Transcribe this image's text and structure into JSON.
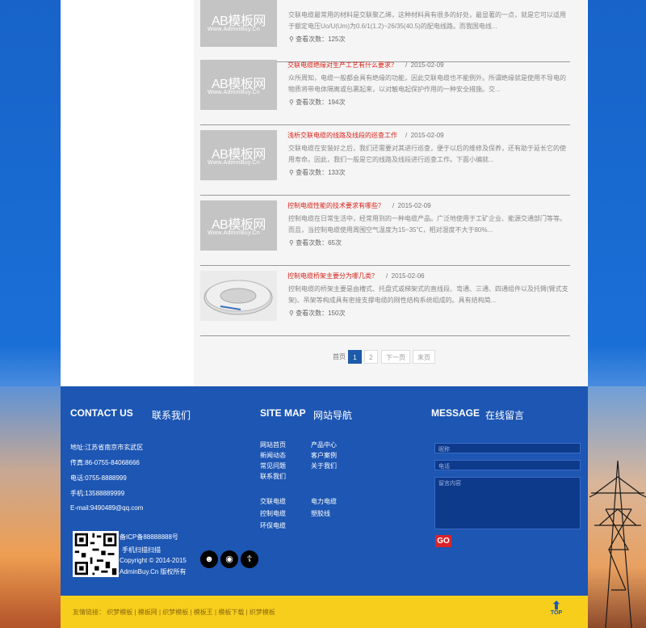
{
  "articles": [
    {
      "title": "",
      "date": "",
      "desc": "交联电缆最常用的材料是交联聚乙烯，这种材料具有很多的好处，最显著的一点，就是它可以适用于额定电压Uo/U(Um)为0.6/1(1.2)~26/35(40.5)的配电线路。而我国电线...",
      "views": "查看次数：125次",
      "thumb_logo": "AB模板网",
      "thumb_sub": "Www.AdminBuy.Cn"
    },
    {
      "title": "交联电缆绝缘对生产工艺有什么要求？",
      "date": "2015-02-09",
      "desc": "众所周知，电缆一般都会具有绝缘的功能，因此交联电缆也不能例外。所谓绝缘就是使用不导电的物质将带电体隔离或包裹起来，以对触电起保护作用的一种安全措施。交...",
      "views": "查看次数：194次",
      "thumb_logo": "AB模板网",
      "thumb_sub": "Www.AdminBuy.Cn"
    },
    {
      "title": "浅析交联电缆的线路及线段的巡查工作",
      "date": "2015-02-09",
      "desc": "交联电缆在安装好之后，我们还需要对其进行巡查，便于以后的维修及保养，还有助于延长它的使用寿命。因此，我们一般是它的线路及线段进行巡查工作。下面小编就...",
      "views": "查看次数：133次",
      "thumb_logo": "AB模板网",
      "thumb_sub": "Www.AdminBuy.Cn"
    },
    {
      "title": "控制电缆性能的技术要求有哪些？",
      "date": "2015-02-09",
      "desc": "控制电缆在日常生活中，经常用到的一种电缆产品。广泛地使用于工矿企业、能源交通部门等等。而且，当控制电缆使用周围空气温度为15~35℃，相对湿度不大于80%...",
      "views": "查看次数：65次",
      "thumb_logo": "AB模板网",
      "thumb_sub": "Www.AdminBuy.Cn"
    },
    {
      "title": "控制电缆桥架主要分为哪几类？",
      "date": "2015-02-06",
      "desc": "控制电缆的桥架主要是由槽式、托盘式或梯架式的直线段、弯通、三通、四通组件以及托臂(臂式支架)、吊架等构成具有密接支撑电缆的刚性结构系统组成的。具有结构简...",
      "views": "查看次数：150次",
      "thumb_logo": "",
      "thumb_sub": ""
    }
  ],
  "pager": {
    "first": "首页",
    "page1": "1",
    "page2": "2",
    "next": "下一页",
    "last": "末页"
  },
  "footer": {
    "contact_en": "CONTACT US",
    "contact_cn": "联系我们",
    "sitemap_en": "SITE MAP",
    "sitemap_cn": "网站导航",
    "message_en": "MESSAGE",
    "message_cn": "在线留言",
    "address": "地址:江苏省南京市玄武区",
    "fax": "传真:86-0755-84068666",
    "phone": "电话:0755-8888999",
    "mobile": "手机:13588889999",
    "email": "E-mail:9490489@qq.com",
    "icp": "备ICP备88888888号",
    "qr_hint": "手机扫描扫描",
    "copyright": "Copyright © 2014-2015",
    "rights": "AdminBuy.Cn 版权所有",
    "nav_col1": [
      "网站首页",
      "新闻动态",
      "常见问题",
      "联系我们"
    ],
    "nav_col2": [
      "产品中心",
      "客户案例",
      "关于我们"
    ],
    "prod_col1": [
      "交联电缆",
      "控制电缆",
      "环保电缆"
    ],
    "prod_col2": [
      "电力电缆",
      "塑胶线"
    ],
    "ph_name": "昵称",
    "ph_phone": "电话",
    "ph_content": "留言内容",
    "go": "GO"
  },
  "friend_links": "友情链接：  织梦模板  |  模板网  |  织梦模板  |  模板王  |  模板下载  |  织梦模板",
  "top_label": "TOP"
}
